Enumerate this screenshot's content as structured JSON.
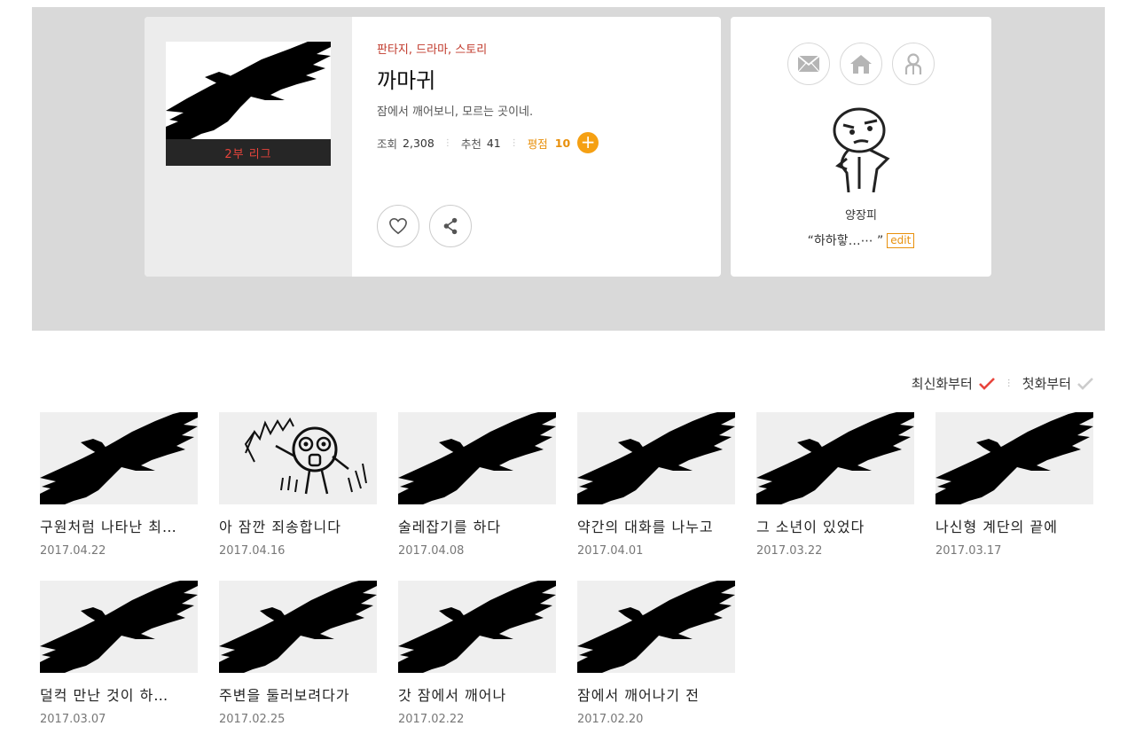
{
  "series": {
    "badge": "2부 리그",
    "genres": "판타지, 드라마, 스토리",
    "title": "까마귀",
    "synopsis": "잠에서 깨어보니, 모르는 곳이네.",
    "stats": {
      "views_label": "조회",
      "views": "2,308",
      "likes_label": "추천",
      "likes": "41",
      "rating_label": "평점",
      "rating": "10"
    }
  },
  "author": {
    "name": "양장피",
    "message": "“하하핳…⋯    ”",
    "edit_label": "edit"
  },
  "sort": {
    "latest": "최신화부터",
    "first": "첫화부터"
  },
  "episodes": [
    {
      "title": "구원처럼 나타난 최…",
      "date": "2017.04.22"
    },
    {
      "title": "아 잠깐 죄송합니다",
      "date": "2017.04.16"
    },
    {
      "title": "술레잡기를 하다",
      "date": "2017.04.08"
    },
    {
      "title": "약간의 대화를 나누고",
      "date": "2017.04.01"
    },
    {
      "title": "그 소년이 있었다",
      "date": "2017.03.22"
    },
    {
      "title": "나신형 계단의 끝에",
      "date": "2017.03.17"
    },
    {
      "title": "덜컥 만난 것이 하…",
      "date": "2017.03.07"
    },
    {
      "title": "주변을 둘러보려다가",
      "date": "2017.02.25"
    },
    {
      "title": "갓 잠에서 깨어나",
      "date": "2017.02.22"
    },
    {
      "title": "잠에서 깨어나기 전",
      "date": "2017.02.20"
    }
  ],
  "colors": {
    "accent_orange": "#f5a013",
    "genre_red": "#c0392b",
    "check_red": "#e8443c"
  }
}
